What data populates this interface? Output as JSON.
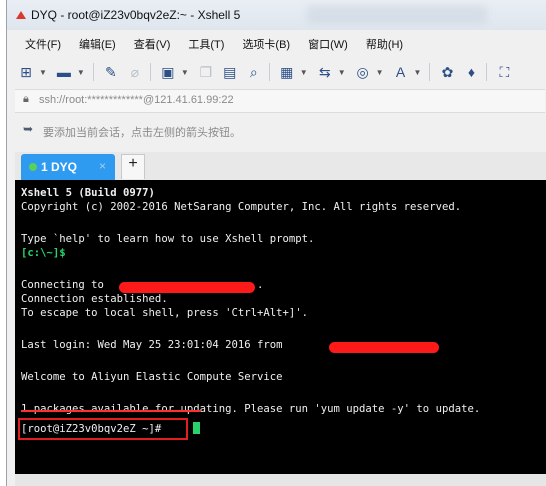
{
  "window": {
    "title": "DYQ - root@iZ23v0bqv2eZ:~ - Xshell 5"
  },
  "menu": [
    "文件(F)",
    "编辑(E)",
    "查看(V)",
    "工具(T)",
    "选项卡(B)",
    "窗口(W)",
    "帮助(H)"
  ],
  "toolbar": {
    "icons": [
      "new-session-icon",
      "open-folder-icon",
      "pen-icon",
      "link-icon",
      "connect-icon",
      "copy-icon",
      "paste-icon",
      "find-icon",
      "print-icon",
      "transfer-icon",
      "globe-icon",
      "font-icon",
      "settings-icon",
      "plugin-icon",
      "fullscreen-icon"
    ]
  },
  "address": {
    "text": "ssh://root:*************@121.41.61.99:22"
  },
  "hint": {
    "text": "要添加当前会话，点击左侧的箭头按钮。"
  },
  "tabs": [
    {
      "label": "1 DYQ",
      "close": "×"
    }
  ],
  "tab_add": "+",
  "terminal": {
    "lines": {
      "l1": "Xshell 5 (Build 0977)",
      "l2": "Copyright (c) 2002-2016 NetSarang Computer, Inc. All rights reserved.",
      "l3": "Type `help' to learn how to use Xshell prompt.",
      "l4": "[c:\\~]$",
      "l5": "Connecting to ",
      "l5b": ".",
      "l6": "Connection established.",
      "l7": "To escape to local shell, press 'Ctrl+Alt+]'.",
      "l8": "Last login: Wed May 25 23:01:04 2016 from ",
      "l9": "Welcome to Aliyun Elastic Compute Service",
      "l10": "1 packages available for updating. Please run 'yum update -y' to update.",
      "l11": "[root@iZ23v0bqv2eZ ~]# "
    }
  },
  "colors": {
    "tab_active": "#2e9bf0",
    "terminal_bg": "#000000",
    "prompt_green": "#28d36b",
    "annotation_red": "#e0201f"
  }
}
